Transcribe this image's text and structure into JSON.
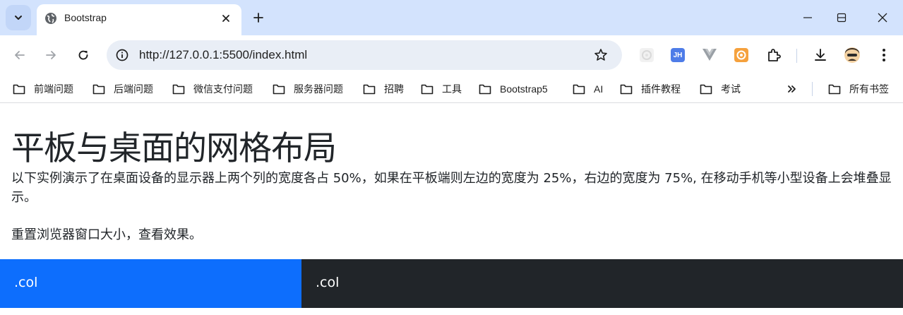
{
  "browser": {
    "tab": {
      "title": "Bootstrap"
    },
    "address": {
      "url": "http://127.0.0.1:5500/index.html"
    },
    "bookmarks": [
      {
        "label": "前端问题"
      },
      {
        "label": "后端问题"
      },
      {
        "label": "微信支付问题"
      },
      {
        "label": "服务器问题"
      },
      {
        "label": "招聘"
      },
      {
        "label": "工具"
      },
      {
        "label": "Bootstrap5"
      },
      {
        "label": "AI"
      },
      {
        "label": "插件教程"
      },
      {
        "label": "考试"
      }
    ],
    "all_bookmarks_label": "所有书签",
    "extensions": {
      "jh_label": "JH"
    },
    "colors": {
      "tabstrip": "#d3e3fd",
      "omnibox": "#e9eef6"
    }
  },
  "page": {
    "heading": "平板与桌面的网格布局",
    "paragraph1": "以下实例演示了在桌面设备的显示器上两个列的宽度各占 50%，如果在平板端则左边的宽度为 25%，右边的宽度为 75%, 在移动手机等小型设备上会堆叠显示。",
    "paragraph2": "重置浏览器窗口大小，查看效果。",
    "columns": [
      {
        "label": ".col",
        "color": "#0d6efd"
      },
      {
        "label": ".col",
        "color": "#212529"
      }
    ]
  }
}
